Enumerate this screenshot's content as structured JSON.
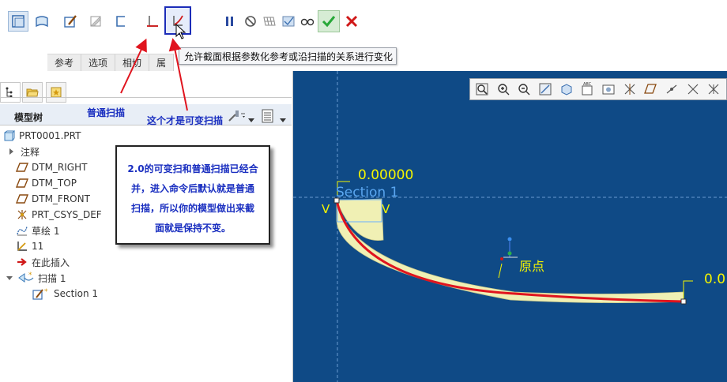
{
  "tooltip": "允许截面根据参数化参考或沿扫描的关系进行变化",
  "ribbon": {
    "tabs": [
      "参考",
      "选项",
      "相切",
      "属"
    ]
  },
  "annotations": {
    "normal_sweep": "普通扫描",
    "variable_sweep": "这个才是可变扫描",
    "note_lines": [
      "2.0的可变扫和普通扫描已经合",
      "并，进入命令后默认就是普通",
      "扫描，所以你的模型做出来截",
      "面就是保持不变。"
    ]
  },
  "model_tree": {
    "title": "模型树",
    "items": [
      {
        "label": "PRT0001.PRT",
        "icon": "part-icon",
        "indent": 0
      },
      {
        "label": "注释",
        "icon": "expand-arrow-icon",
        "indent": 0
      },
      {
        "label": "DTM_RIGHT",
        "icon": "datum-plane-icon",
        "indent": 1
      },
      {
        "label": "DTM_TOP",
        "icon": "datum-plane-icon",
        "indent": 1
      },
      {
        "label": "DTM_FRONT",
        "icon": "datum-plane-icon",
        "indent": 1
      },
      {
        "label": "PRT_CSYS_DEF",
        "icon": "csys-icon",
        "indent": 1
      },
      {
        "label": "草绘 1",
        "icon": "sketch-icon",
        "indent": 1
      },
      {
        "label": "11",
        "icon": "datum-axis-icon",
        "indent": 1
      },
      {
        "label": "在此插入",
        "icon": "insert-arrow-icon",
        "indent": 1
      },
      {
        "label": "扫描 1",
        "icon": "sweep-icon",
        "indent": 0
      },
      {
        "label": "Section 1",
        "icon": "section-icon",
        "indent": 2
      }
    ]
  },
  "graphics": {
    "dim_left": "0.00000",
    "dim_right": "0.0",
    "section_label": "Section 1",
    "origin_label": "原点",
    "v_left": "V",
    "v_right": "V"
  },
  "colors": {
    "accent": "#1c2db8",
    "graphics_bg": "#0f4a86",
    "sweep_fill": "#f0f0b4",
    "trajectory": "#e0141e",
    "dim_text": "#f5f500",
    "confirm": "#27a838",
    "cancel": "#d01818"
  }
}
